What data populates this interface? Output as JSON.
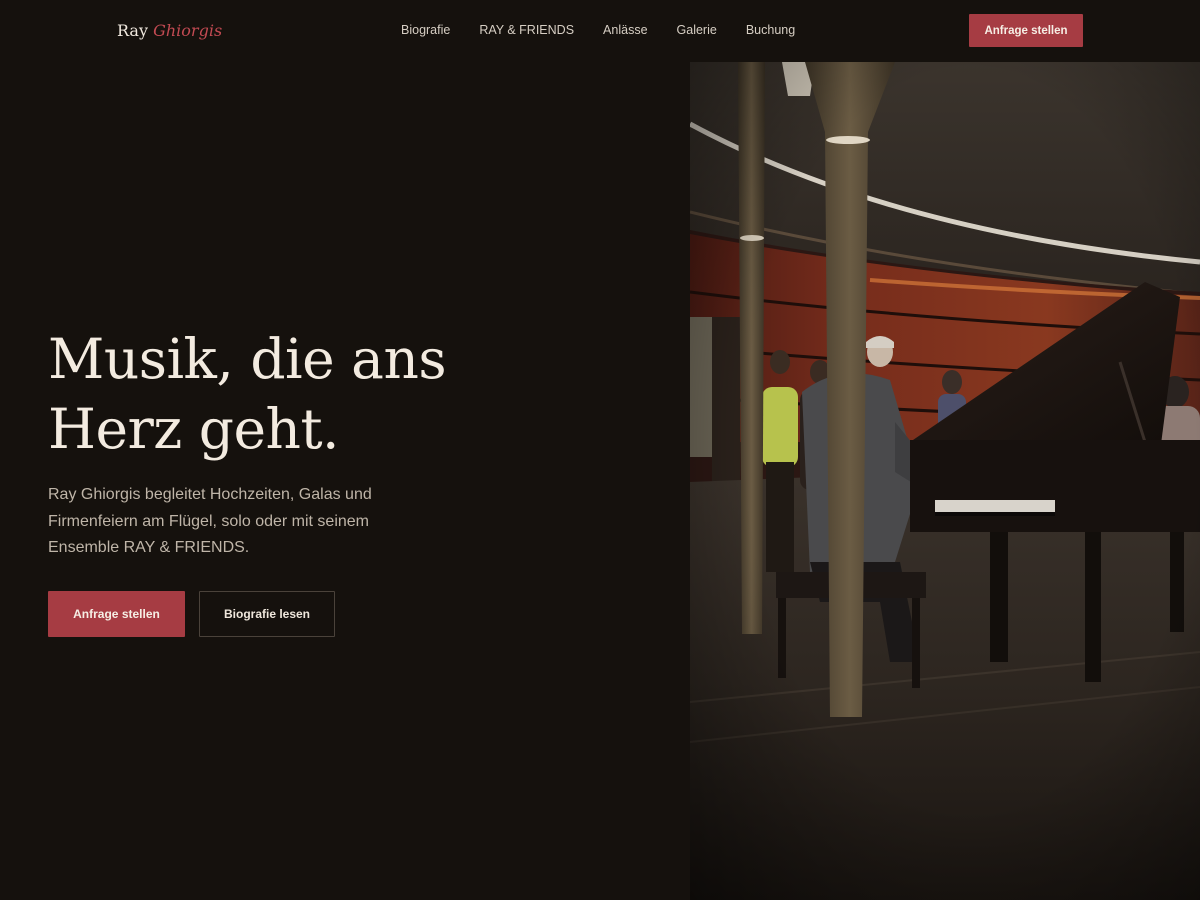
{
  "brand": {
    "first_name": "Ray",
    "last_name": "Ghiorgis"
  },
  "nav": {
    "items": [
      {
        "label": "Biografie"
      },
      {
        "label": "RAY & FRIENDS"
      },
      {
        "label": "Anlässe"
      },
      {
        "label": "Galerie"
      },
      {
        "label": "Buchung"
      }
    ],
    "cta_label": "Anfrage stellen"
  },
  "hero": {
    "title_line1": "Musik, die ans",
    "title_line2": "Herz geht.",
    "description": "Ray Ghiorgis begleitet Hochzeiten, Galas und Firmenfeiern am Flügel, solo oder mit seinem Ensemble RAY & FRIENDS.",
    "primary_button": "Anfrage stellen",
    "secondary_button": "Biografie lesen",
    "image_icon": "photo-pianist-at-grand-piano"
  },
  "colors": {
    "background": "#15110d",
    "accent": "#a63c43",
    "logo_accent": "#c24a52",
    "text": "#f3ebe0",
    "muted_text": "#bfb5a8"
  }
}
